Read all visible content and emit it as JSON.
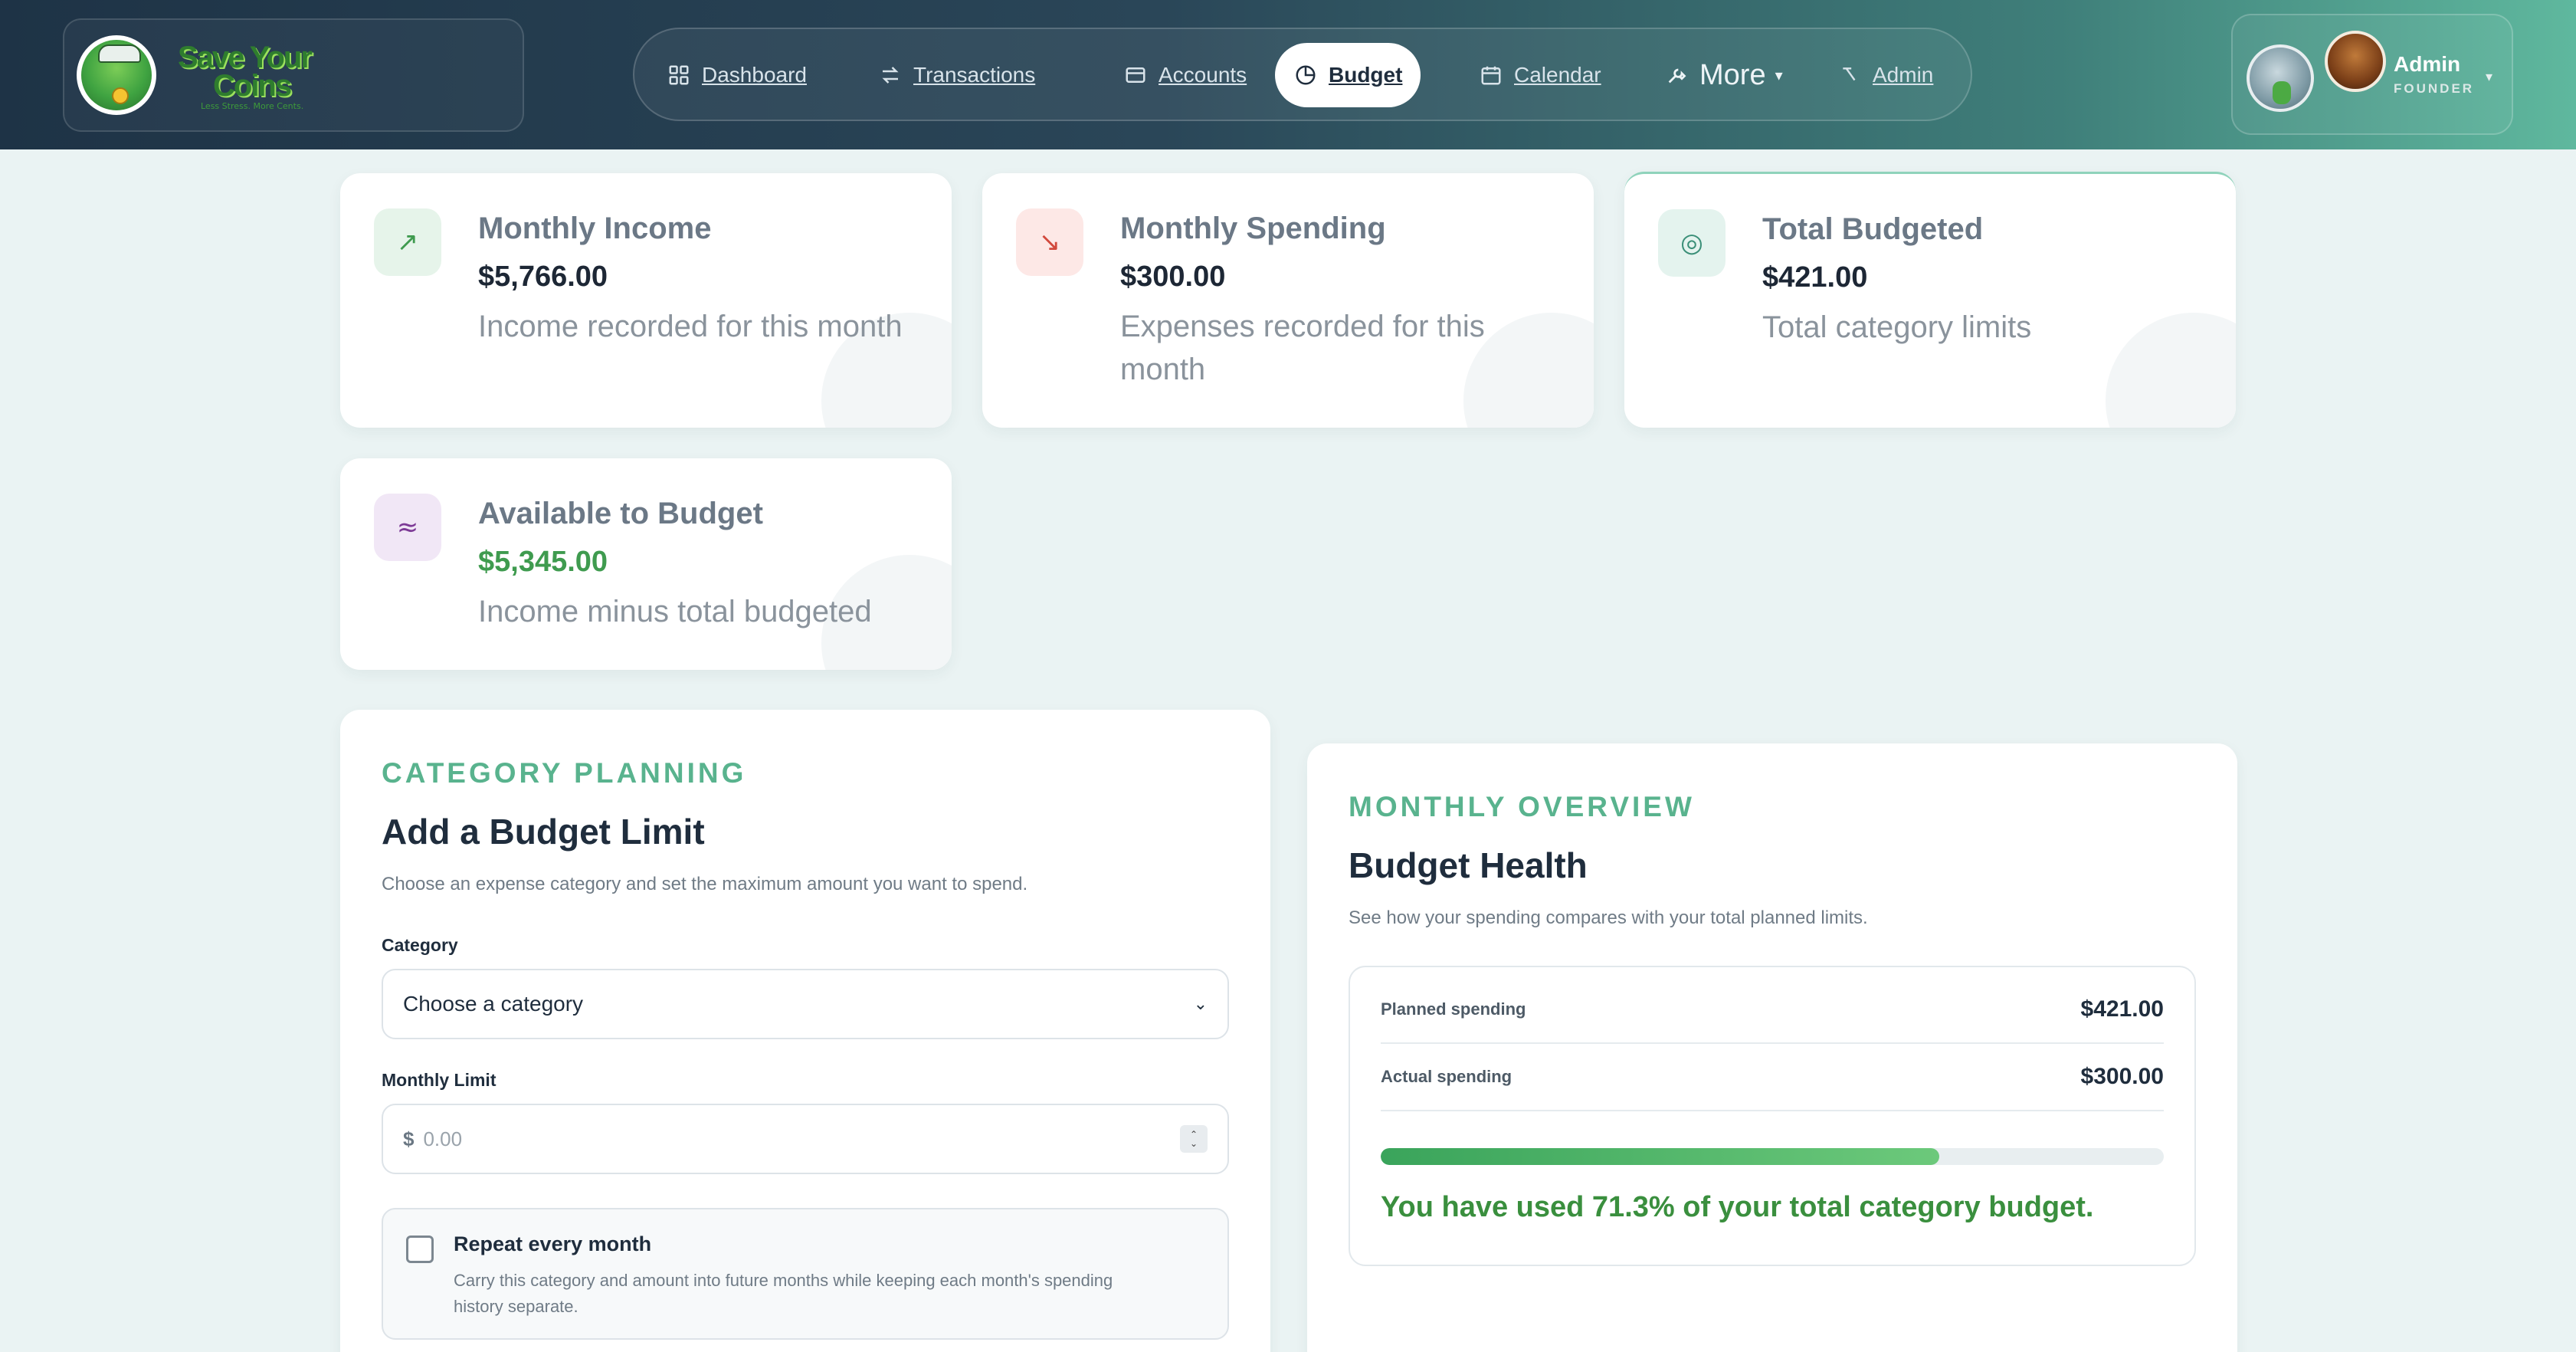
{
  "brand": {
    "name_line1": "Save Your",
    "name_line2": "Coins",
    "tagline": "Less Stress. More Cents."
  },
  "nav": {
    "items": [
      {
        "label": "Dashboard",
        "icon": "grid-icon"
      },
      {
        "label": "Transactions",
        "icon": "arrows-swap-icon"
      },
      {
        "label": "Accounts",
        "icon": "wallet-icon"
      },
      {
        "label": "Budget",
        "icon": "pie-chart-icon",
        "active": true
      },
      {
        "label": "Calendar",
        "icon": "calendar-icon"
      },
      {
        "label": "More",
        "icon": "wrench-icon"
      },
      {
        "label": "Admin",
        "icon": "admin-arrow-icon"
      }
    ]
  },
  "user": {
    "name": "Admin",
    "role": "FOUNDER",
    "caret": "▾"
  },
  "stats": [
    {
      "title": "Monthly Income",
      "value": "$5,766.00",
      "desc": "Income recorded for this month",
      "icon": "trend-up-icon",
      "glyph": "↗",
      "icon_bg": "#e6f4ea",
      "icon_color": "#3f9b4f",
      "value_color": "#1d2735"
    },
    {
      "title": "Monthly Spending",
      "value": "$300.00",
      "desc": "Expenses recorded for this month",
      "icon": "trend-down-icon",
      "glyph": "↘",
      "icon_bg": "#fde8e6",
      "icon_color": "#d2493d",
      "value_color": "#1d2735"
    },
    {
      "title": "Total Budgeted",
      "value": "$421.00",
      "desc": "Total category limits",
      "icon": "target-icon",
      "glyph": "◎",
      "icon_bg": "#e4f3ee",
      "icon_color": "#3b8f78",
      "value_color": "#1d2735"
    },
    {
      "title": "Available to Budget",
      "value": "$5,345.00",
      "desc": "Income minus total budgeted",
      "icon": "approx-icon",
      "glyph": "≈",
      "icon_bg": "#f1e7f6",
      "icon_color": "#7d3a96",
      "value_color": "#3f9b4f"
    }
  ],
  "planning": {
    "eyebrow": "CATEGORY PLANNING",
    "title": "Add a Budget Limit",
    "subtitle": "Choose an expense category and set the maximum amount you want to spend.",
    "category_label": "Category",
    "category_value": "Choose a category",
    "limit_label": "Monthly Limit",
    "currency": "$",
    "limit_placeholder": "0.00",
    "repeat_title": "Repeat every month",
    "repeat_desc": "Carry this category and amount into future months while keeping each month's spending history separate."
  },
  "overview": {
    "eyebrow": "MONTHLY OVERVIEW",
    "title": "Budget Health",
    "subtitle": "See how your spending compares with your total planned limits.",
    "planned_label": "Planned spending",
    "planned_value": "$421.00",
    "actual_label": "Actual spending",
    "actual_value": "$300.00",
    "used_fraction": 0.713,
    "message": "You have used 71.3% of your total category budget."
  }
}
